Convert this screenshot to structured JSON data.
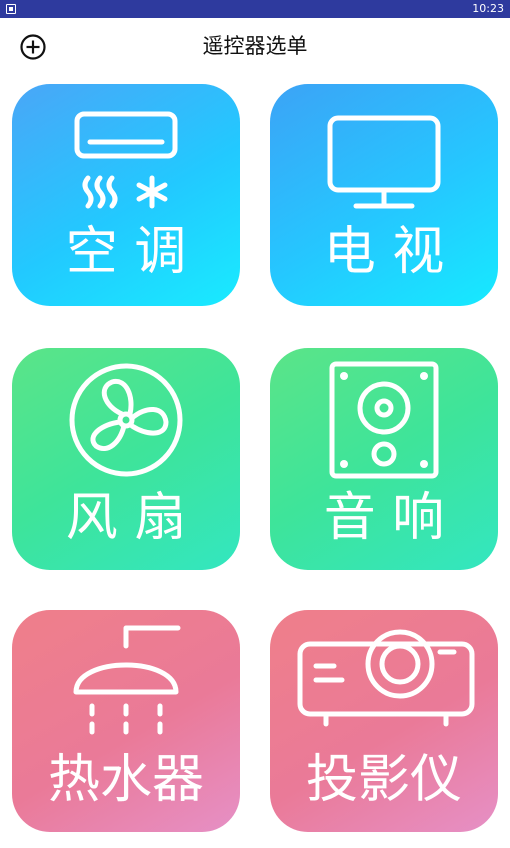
{
  "status_bar": {
    "time": "10:23"
  },
  "header": {
    "title": "遥控器选单"
  },
  "devices": [
    {
      "label": "空 调",
      "icon": "air-conditioner-icon"
    },
    {
      "label": "电 视",
      "icon": "tv-icon"
    },
    {
      "label": "风 扇",
      "icon": "fan-icon"
    },
    {
      "label": "音 响",
      "icon": "speaker-icon"
    },
    {
      "label": "热水器",
      "icon": "water-heater-icon"
    },
    {
      "label": "投影仪",
      "icon": "projector-icon"
    }
  ],
  "colors": {
    "status_bar": "#2e3a9e",
    "blue_start": "#4aa6f7",
    "blue_end": "#19ebff",
    "green_start": "#5be488",
    "green_end": "#33e6c0",
    "pink_start": "#ef7f8a",
    "pink_end": "#e690c6"
  }
}
